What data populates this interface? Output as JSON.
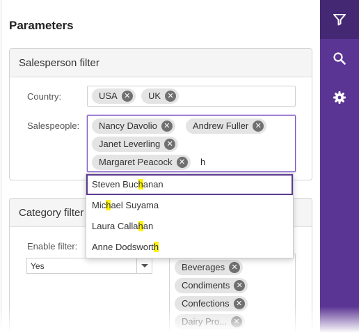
{
  "panel": {
    "title": "Parameters"
  },
  "salesperson_filter": {
    "header": "Salesperson filter",
    "country_label": "Country:",
    "country_tags": [
      "USA",
      "UK"
    ],
    "salespeople_label": "Salespeople:",
    "salespeople_tags": [
      "Nancy Davolio",
      "Andrew Fuller",
      "Janet Leverling",
      "Margaret Peacock"
    ],
    "typed_text": "h"
  },
  "autocomplete": {
    "items": [
      {
        "before": "Steven Buc",
        "match": "h",
        "after": "anan"
      },
      {
        "before": "Mic",
        "match": "h",
        "after": "ael Suyama"
      },
      {
        "before": "Laura Calla",
        "match": "h",
        "after": "an"
      },
      {
        "before": "Anne Dodswort",
        "match": "h",
        "after": ""
      }
    ]
  },
  "category_filter": {
    "header": "Category filter",
    "enable_label": "Enable filter:",
    "enable_value": "Yes",
    "category_tags": [
      "Beverages",
      "Condiments",
      "Confections",
      "Dairy Pro..."
    ]
  },
  "sidebar": {
    "buttons": [
      {
        "icon": "filter-icon",
        "active": true
      },
      {
        "icon": "search-icon",
        "active": false
      },
      {
        "icon": "gear-icon",
        "active": false
      }
    ]
  },
  "colors": {
    "sidebar": "#5b3594",
    "sidebar_active": "#442873",
    "highlight": "#fff200",
    "focus_border": "#7e57c2"
  }
}
